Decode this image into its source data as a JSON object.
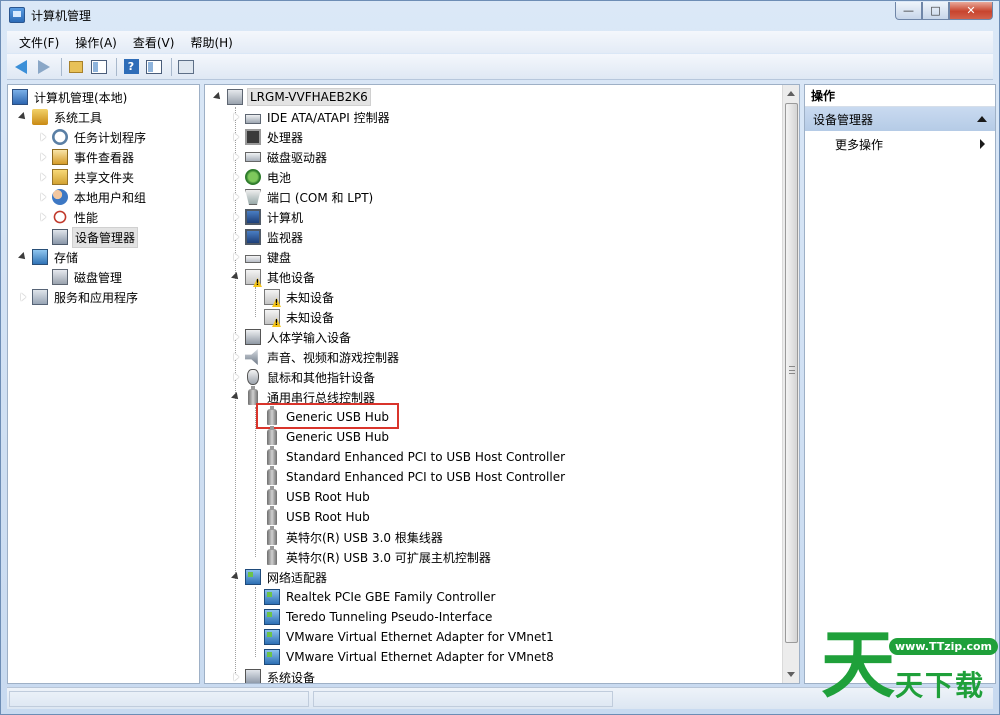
{
  "window": {
    "title": "计算机管理",
    "controls": {
      "minimize": "—",
      "maximize": "□",
      "close": "✕"
    }
  },
  "menubar": [
    "文件(F)",
    "操作(A)",
    "查看(V)",
    "帮助(H)"
  ],
  "toolbar": {
    "icons": [
      "back-arrow-icon",
      "forward-arrow-icon",
      "up-folder-icon",
      "show-hide-tree-icon",
      "help-icon",
      "show-hide-action-pane-icon",
      "scan-hardware-icon"
    ]
  },
  "left_tree": {
    "root": "计算机管理(本地)",
    "system_tools": "系统工具",
    "task_scheduler": "任务计划程序",
    "event_viewer": "事件查看器",
    "shared_folders": "共享文件夹",
    "local_users": "本地用户和组",
    "performance": "性能",
    "device_manager": "设备管理器",
    "storage": "存储",
    "disk_management": "磁盘管理",
    "services_apps": "服务和应用程序"
  },
  "device_tree": {
    "computer": "LRGM-VVFHAEB2K6",
    "ide": "IDE ATA/ATAPI 控制器",
    "processors": "处理器",
    "disk_drives": "磁盘驱动器",
    "battery": "电池",
    "ports": "端口 (COM 和 LPT)",
    "computer_cat": "计算机",
    "monitors": "监视器",
    "keyboards": "键盘",
    "other_devices": "其他设备",
    "unknown1": "未知设备",
    "unknown2": "未知设备",
    "hid": "人体学输入设备",
    "sound": "声音、视频和游戏控制器",
    "mice": "鼠标和其他指针设备",
    "usb_controllers": "通用串行总线控制器",
    "usb_items": [
      "Generic USB Hub",
      "Generic USB Hub",
      "Standard Enhanced PCI to USB Host Controller",
      "Standard Enhanced PCI to USB Host Controller",
      "USB Root Hub",
      "USB Root Hub",
      "英特尔(R) USB 3.0 根集线器",
      "英特尔(R) USB 3.0 可扩展主机控制器"
    ],
    "network": "网络适配器",
    "net_items": [
      "Realtek PCIe GBE Family Controller",
      "Teredo Tunneling Pseudo-Interface",
      "VMware Virtual Ethernet Adapter for VMnet1",
      "VMware Virtual Ethernet Adapter for VMnet8"
    ],
    "system_devices": "系统设备"
  },
  "actions": {
    "header": "操作",
    "section": "设备管理器",
    "more": "更多操作"
  },
  "watermark": {
    "big": "天",
    "url": "www.TTzip.com",
    "text": "天下载"
  },
  "colors": {
    "highlight": "#d9342b",
    "watermark": "#1fa03a",
    "action_section": "#c9daf0"
  }
}
